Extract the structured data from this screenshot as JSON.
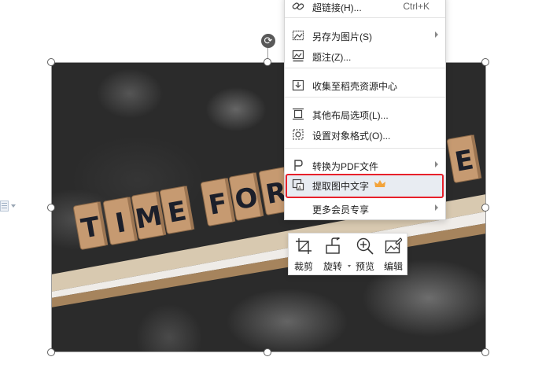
{
  "context_menu": {
    "items": [
      {
        "label": "超链接(H)...",
        "shortcut": "Ctrl+K",
        "icon": "link-icon"
      },
      {
        "label": "另存为图片(S)",
        "icon": "save-image-icon",
        "submenu": true
      },
      {
        "label": "题注(Z)...",
        "icon": "caption-icon"
      },
      {
        "label": "收集至稻壳资源中心",
        "icon": "collect-icon"
      },
      {
        "label": "其他布局选项(L)...",
        "icon": "layout-icon"
      },
      {
        "label": "设置对象格式(O)...",
        "icon": "format-object-icon"
      },
      {
        "label": "转换为PDF文件",
        "icon": "pdf-icon",
        "submenu": true
      },
      {
        "label": "提取图中文字",
        "icon": "extract-text-icon",
        "badge": "crown-icon",
        "highlighted": true
      },
      {
        "label": "更多会员专享",
        "submenu": true
      }
    ]
  },
  "picture": {
    "tiles_line1": [
      "T",
      "I",
      "M",
      "E",
      "F",
      "O",
      "R"
    ],
    "tiles_line2": [
      "E"
    ]
  },
  "quick_bar": {
    "crop": "裁剪",
    "rotate": "旋转",
    "preview": "预览",
    "edit": "编辑"
  },
  "colors": {
    "highlight_border": "#e8202a",
    "crown": "#f3a33a",
    "tile": "#c69a71",
    "letter": "#1c1f2a"
  }
}
